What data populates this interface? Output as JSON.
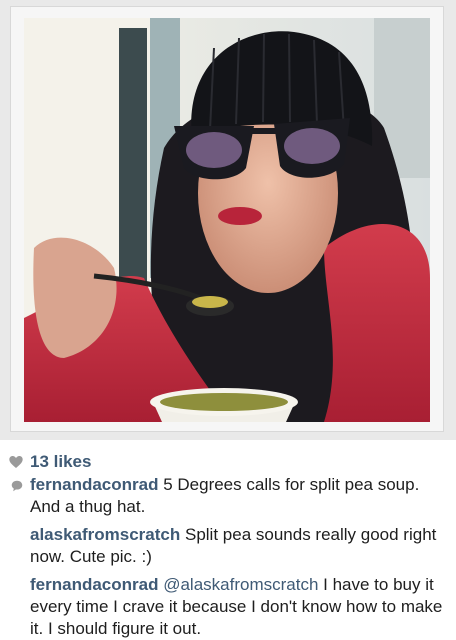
{
  "likes": {
    "icon": "heart-icon",
    "text": "13 likes"
  },
  "comments": [
    {
      "icon": "comment-bubble-icon",
      "user": "fernandaconrad",
      "text": " 5 Degrees calls for split pea soup. And a thug hat."
    },
    {
      "user": "alaskafromscratch",
      "text": " Split pea sounds really good right now. Cute pic. :)"
    },
    {
      "user": "fernandaconrad",
      "mention": "@alaskafromscratch",
      "text": " I have to buy it every time I crave it because I don't know how to make it. I should figure it out."
    }
  ],
  "colors": {
    "username": "#3f5a75",
    "text": "#1e1e1e",
    "background": "#ffffff"
  }
}
